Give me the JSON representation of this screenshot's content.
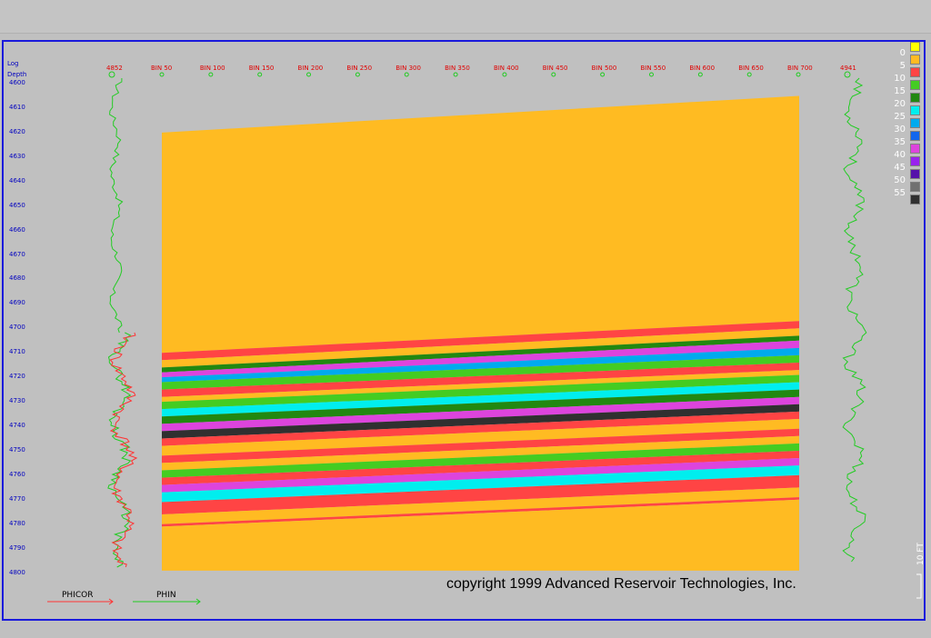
{
  "window": {
    "copyright": "copyright 1999 Advanced Reservoir Technologies, Inc."
  },
  "depth_header": {
    "line1": "Log",
    "line2": "Depth"
  },
  "well_left": "4852",
  "well_right": "4941",
  "bins": [
    "BIN 50",
    "BIN 100",
    "BIN 150",
    "BIN 200",
    "BIN 250",
    "BIN 300",
    "BIN 350",
    "BIN 400",
    "BIN 450",
    "BIN 500",
    "BIN 550",
    "BIN 600",
    "BIN 650",
    "BIN 700"
  ],
  "depth_ticks": [
    "4600",
    "4610",
    "4620",
    "4630",
    "4640",
    "4650",
    "4660",
    "4670",
    "4680",
    "4690",
    "4700",
    "4710",
    "4720",
    "4730",
    "4740",
    "4750",
    "4760",
    "4770",
    "4780",
    "4790",
    "4800"
  ],
  "legend": [
    {
      "label": "0",
      "color": "#ffff00"
    },
    {
      "label": "5",
      "color": "#ffbb22"
    },
    {
      "label": "10",
      "color": "#ff4444"
    },
    {
      "label": "15",
      "color": "#44cc22"
    },
    {
      "label": "20",
      "color": "#228811"
    },
    {
      "label": "25",
      "color": "#00eeee"
    },
    {
      "label": "30",
      "color": "#00aaee"
    },
    {
      "label": "35",
      "color": "#1166ee"
    },
    {
      "label": "40",
      "color": "#dd44dd"
    },
    {
      "label": "45",
      "color": "#9922ee"
    },
    {
      "label": "50",
      "color": "#5511aa"
    },
    {
      "label": "55",
      "color": "#707070"
    },
    {
      "label": "",
      "color": "#303030"
    }
  ],
  "scale_label": "10 FT",
  "curves": {
    "phicor": {
      "label": "PHICOR",
      "color": "#ff3333"
    },
    "phin": {
      "label": "PHIN",
      "color": "#22cc22"
    }
  },
  "chart_data": {
    "type": "heatmap",
    "xlabel": "",
    "ylabel": "Log Depth",
    "ylim": [
      4600,
      4800
    ],
    "bands": [
      {
        "value": 5,
        "top_left": 4620,
        "top_right": 4605
      },
      {
        "value": 10,
        "top_left": 4710,
        "top_right": 4697
      },
      {
        "value": 5,
        "top_left": 4713,
        "top_right": 4700
      },
      {
        "value": 20,
        "top_left": 4716,
        "top_right": 4703
      },
      {
        "value": 40,
        "top_left": 4718,
        "top_right": 4705
      },
      {
        "value": 30,
        "top_left": 4720,
        "top_right": 4708
      },
      {
        "value": 15,
        "top_left": 4722,
        "top_right": 4711
      },
      {
        "value": 10,
        "top_left": 4725,
        "top_right": 4714
      },
      {
        "value": 5,
        "top_left": 4728,
        "top_right": 4717
      },
      {
        "value": 15,
        "top_left": 4730,
        "top_right": 4719
      },
      {
        "value": 25,
        "top_left": 4733,
        "top_right": 4722
      },
      {
        "value": 20,
        "top_left": 4736,
        "top_right": 4725
      },
      {
        "value": 40,
        "top_left": 4739,
        "top_right": 4728
      },
      {
        "value": 55,
        "top_left": 4742,
        "top_right": 4731
      },
      {
        "value": 10,
        "top_left": 4745,
        "top_right": 4734
      },
      {
        "value": 5,
        "top_left": 4748,
        "top_right": 4737
      },
      {
        "value": 10,
        "top_left": 4752,
        "top_right": 4741
      },
      {
        "value": 5,
        "top_left": 4755,
        "top_right": 4744
      },
      {
        "value": 15,
        "top_left": 4758,
        "top_right": 4747
      },
      {
        "value": 10,
        "top_left": 4761,
        "top_right": 4750
      },
      {
        "value": 40,
        "top_left": 4764,
        "top_right": 4753
      },
      {
        "value": 25,
        "top_left": 4767,
        "top_right": 4756
      },
      {
        "value": 10,
        "top_left": 4771,
        "top_right": 4760
      },
      {
        "value": 5,
        "top_left": 4776,
        "top_right": 4765
      },
      {
        "value": 10,
        "top_left": 4780,
        "top_right": 4769
      },
      {
        "value": 5,
        "top_left": 4781,
        "top_right": 4770
      }
    ],
    "base_depth": 4799
  }
}
